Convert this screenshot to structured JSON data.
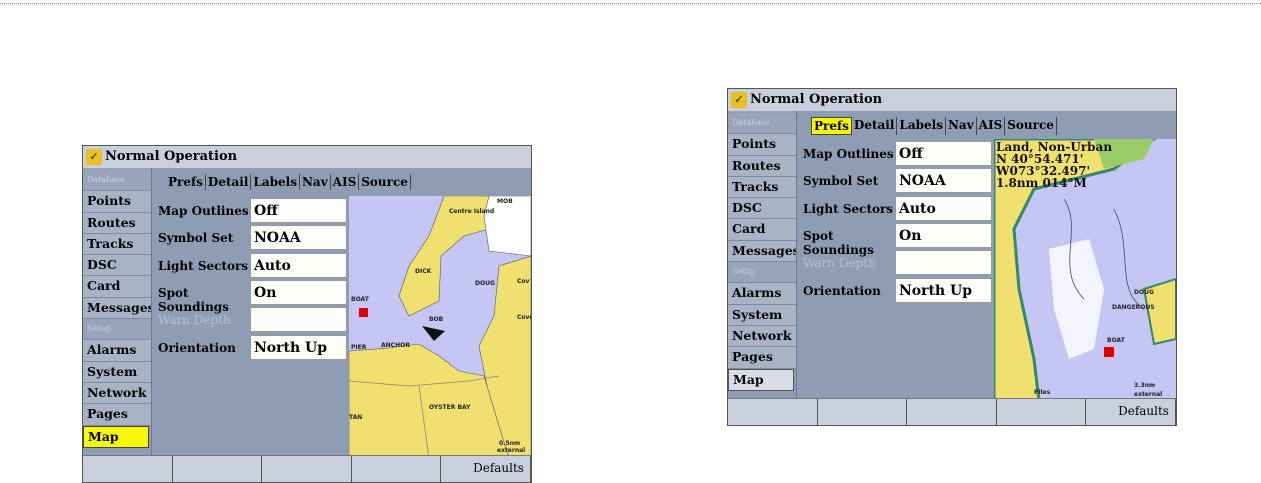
{
  "screens": [
    {
      "title": "Normal Operation",
      "sidebar": [
        "Database",
        "Points",
        "Routes",
        "Tracks",
        "DSC",
        "Card",
        "Messages",
        "Setup",
        "Alarms",
        "System",
        "Network",
        "Pages",
        "Map"
      ],
      "selected_sidebar": "Map",
      "sidebar_highlight": "yellow",
      "tabs": [
        "Prefs",
        "Detail",
        "Labels",
        "Nav",
        "AIS",
        "Source"
      ],
      "active_tab": "Prefs",
      "active_tab_highlight": false,
      "settings": [
        {
          "label": "Map Outlines",
          "value": "Off"
        },
        {
          "label": "Symbol Set",
          "value": "NOAA"
        },
        {
          "label": "Light Sectors",
          "value": "Auto"
        },
        {
          "label": "Spot Soundings",
          "value": "On"
        },
        {
          "label": "Warn Depth",
          "value": "",
          "disabled": true
        },
        {
          "label": "Orientation",
          "value": "North Up"
        }
      ],
      "map_labels": [
        "Centre Island",
        "MOB",
        "DICK",
        "BOAT",
        "DOUG",
        "Cov",
        "Cove",
        "BOB",
        "PIER",
        "ANCHOR",
        "OYSTER BAY",
        "TAN",
        "0.5nm",
        "external"
      ],
      "buttons": [
        "",
        "",
        "",
        "",
        "Defaults"
      ]
    },
    {
      "title": "Normal Operation",
      "sidebar": [
        "Database",
        "Points",
        "Routes",
        "Tracks",
        "DSC",
        "Card",
        "Messages",
        "Setup",
        "Alarms",
        "System",
        "Network",
        "Pages",
        "Map"
      ],
      "selected_sidebar": "Map",
      "sidebar_highlight": "white",
      "tabs": [
        "Prefs",
        "Detail",
        "Labels",
        "Nav",
        "AIS",
        "Source"
      ],
      "active_tab": "Prefs",
      "active_tab_highlight": true,
      "settings": [
        {
          "label": "Map Outlines",
          "value": "Off"
        },
        {
          "label": "Symbol Set",
          "value": "NOAA"
        },
        {
          "label": "Light Sectors",
          "value": "Auto"
        },
        {
          "label": "Spot Soundings",
          "value": "On"
        },
        {
          "label": "Warn Depth",
          "value": "",
          "disabled": true
        },
        {
          "label": "Orientation",
          "value": "North Up"
        }
      ],
      "map_info": {
        "title": "Land, Non-Urban",
        "lat": "N 40°54.471'",
        "lon": "W073°32.497'",
        "distance": "1.8nm",
        "bearing": "014°M"
      },
      "map_labels": [
        "DANGEROUS",
        "BOAT",
        "Piles",
        "DOUG",
        "3.3nm",
        "external"
      ],
      "buttons": [
        "",
        "",
        "",
        "",
        "Defaults"
      ]
    }
  ]
}
